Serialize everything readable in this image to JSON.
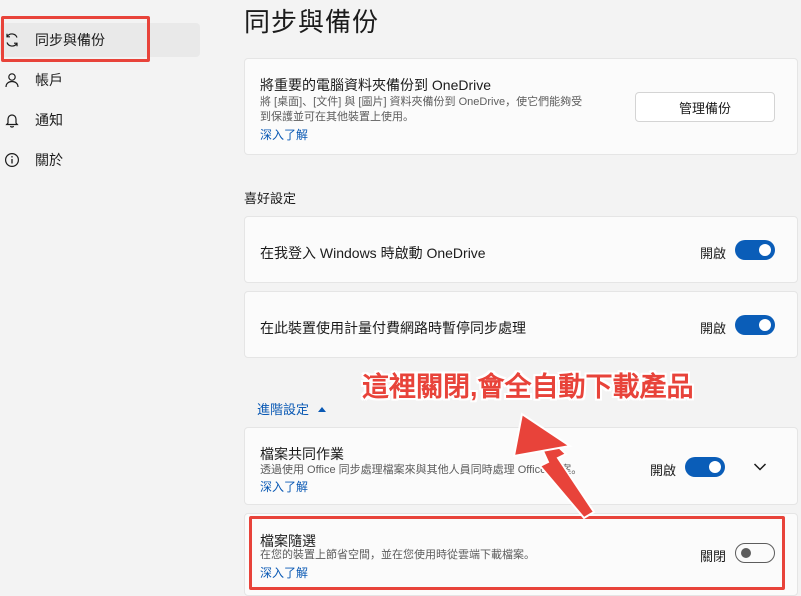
{
  "sidebar": {
    "items": [
      {
        "label": "同步與備份",
        "icon": "sync-icon"
      },
      {
        "label": "帳戶",
        "icon": "person-icon"
      },
      {
        "label": "通知",
        "icon": "bell-icon"
      },
      {
        "label": "關於",
        "icon": "info-icon"
      }
    ]
  },
  "page": {
    "title": "同步與備份"
  },
  "backup_card": {
    "title": "將重要的電腦資料夾備份到 OneDrive",
    "desc_line1": "將 [桌面]、[文件] 與 [圖片] 資料夾備份到 OneDrive，使它們能夠受",
    "desc_line2": "到保護並可在其他裝置上使用。",
    "link": "深入了解",
    "button": "管理備份"
  },
  "preferences": {
    "label": "喜好設定",
    "items": [
      {
        "title": "在我登入 Windows 時啟動 OneDrive",
        "state": "開啟",
        "on": true
      },
      {
        "title": "在此裝置使用計量付費網路時暫停同步處理",
        "state": "開啟",
        "on": true
      }
    ]
  },
  "advanced": {
    "label": "進階設定",
    "coauthoring": {
      "title": "檔案共同作業",
      "desc": "透過使用 Office 同步處理檔案來與其他人員同時處理 Office 檔案。",
      "link": "深入了解",
      "state": "開啟",
      "on": true
    },
    "files_on_demand": {
      "title": "檔案隨選",
      "desc": "在您的裝置上節省空間，並在您使用時從雲端下載檔案。",
      "link": "深入了解",
      "state": "關閉",
      "on": false
    }
  },
  "annotation": {
    "text": "這裡關閉,會全自動下載產品",
    "color": "#e8433a"
  },
  "colors": {
    "accent": "#0a5db8",
    "link": "#0a59b4",
    "annotation_red": "#e8433a"
  }
}
